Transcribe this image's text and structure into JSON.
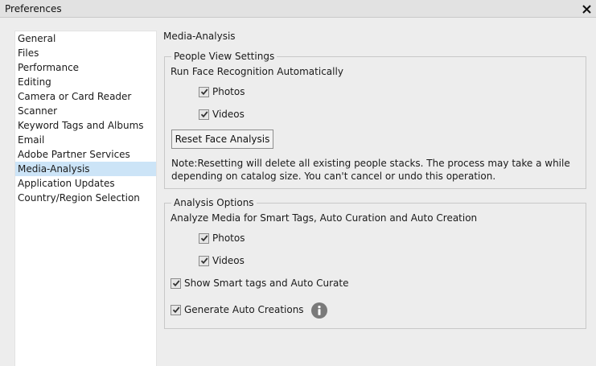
{
  "window": {
    "title": "Preferences"
  },
  "sidebar": {
    "items": [
      {
        "label": "General"
      },
      {
        "label": "Files"
      },
      {
        "label": "Performance"
      },
      {
        "label": "Editing"
      },
      {
        "label": "Camera or Card Reader"
      },
      {
        "label": "Scanner"
      },
      {
        "label": "Keyword Tags and Albums"
      },
      {
        "label": "Email"
      },
      {
        "label": "Adobe Partner Services"
      },
      {
        "label": "Media-Analysis",
        "selected": true
      },
      {
        "label": "Application Updates"
      },
      {
        "label": "Country/Region Selection"
      }
    ]
  },
  "main": {
    "section_title": "Media-Analysis",
    "people_view": {
      "legend": "People View Settings",
      "run_face_label": "Run Face Recognition Automatically",
      "photos": {
        "label": "Photos",
        "checked": true
      },
      "videos": {
        "label": "Videos",
        "checked": true
      },
      "reset_button": "Reset Face Analysis",
      "note": "Note:Resetting will delete all existing people stacks. The process may take a while depending on catalog size. You can't cancel or undo this operation."
    },
    "analysis": {
      "legend": "Analysis Options",
      "analyze_label": "Analyze Media for Smart Tags, Auto Curation and Auto Creation",
      "photos": {
        "label": "Photos",
        "checked": true
      },
      "videos": {
        "label": "Videos",
        "checked": true
      },
      "smart_tags": {
        "label": "Show Smart tags and Auto Curate",
        "checked": true
      },
      "auto_creations": {
        "label": "Generate Auto Creations",
        "checked": true
      }
    }
  },
  "colors": {
    "selection": "#cce4f7",
    "info_icon": "#7a7a7a"
  }
}
